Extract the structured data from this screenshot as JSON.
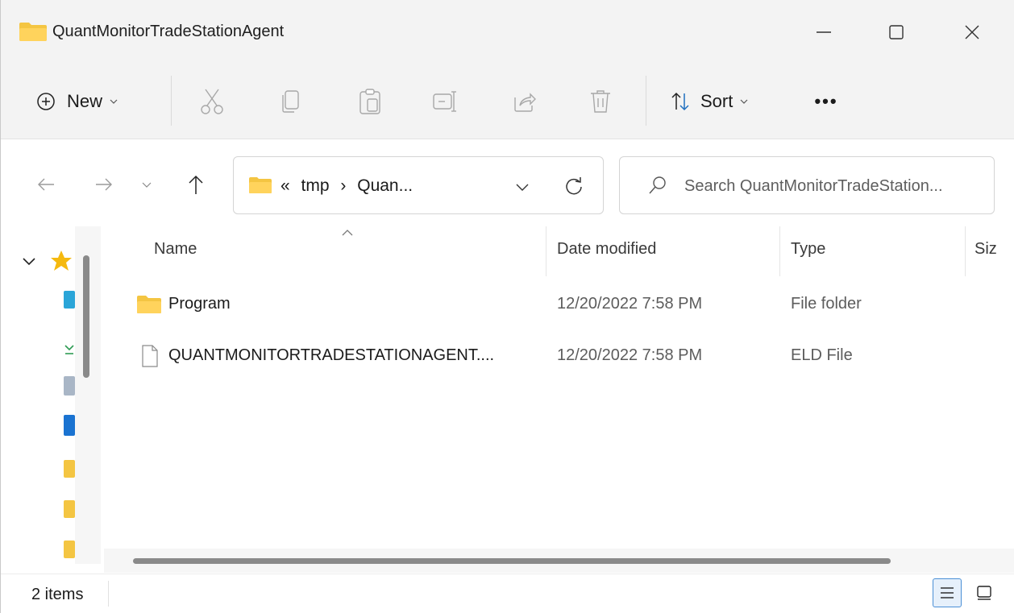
{
  "window": {
    "title": "QuantMonitorTradeStationAgent"
  },
  "commandbar": {
    "new_label": "New",
    "sort_label": "Sort",
    "more_label": "•••"
  },
  "address": {
    "overflow": "«",
    "segment_1": "tmp",
    "separator": "›",
    "segment_2": "Quan..."
  },
  "search": {
    "placeholder": "Search QuantMonitorTradeStation..."
  },
  "columns": {
    "name": "Name",
    "date": "Date modified",
    "type": "Type",
    "size": "Siz"
  },
  "files": [
    {
      "name": "Program",
      "date": "12/20/2022 7:58 PM",
      "type": "File folder",
      "icon": "folder-icon"
    },
    {
      "name": "QUANTMONITORTRADESTATIONAGENT....",
      "date": "12/20/2022 7:58 PM",
      "type": "ELD File",
      "icon": "file-icon"
    }
  ],
  "status": {
    "item_count": "2 items"
  },
  "colors": {
    "folder": "#f4c542",
    "accent": "#4a8fd6",
    "chrome": "#f3f3f3"
  }
}
